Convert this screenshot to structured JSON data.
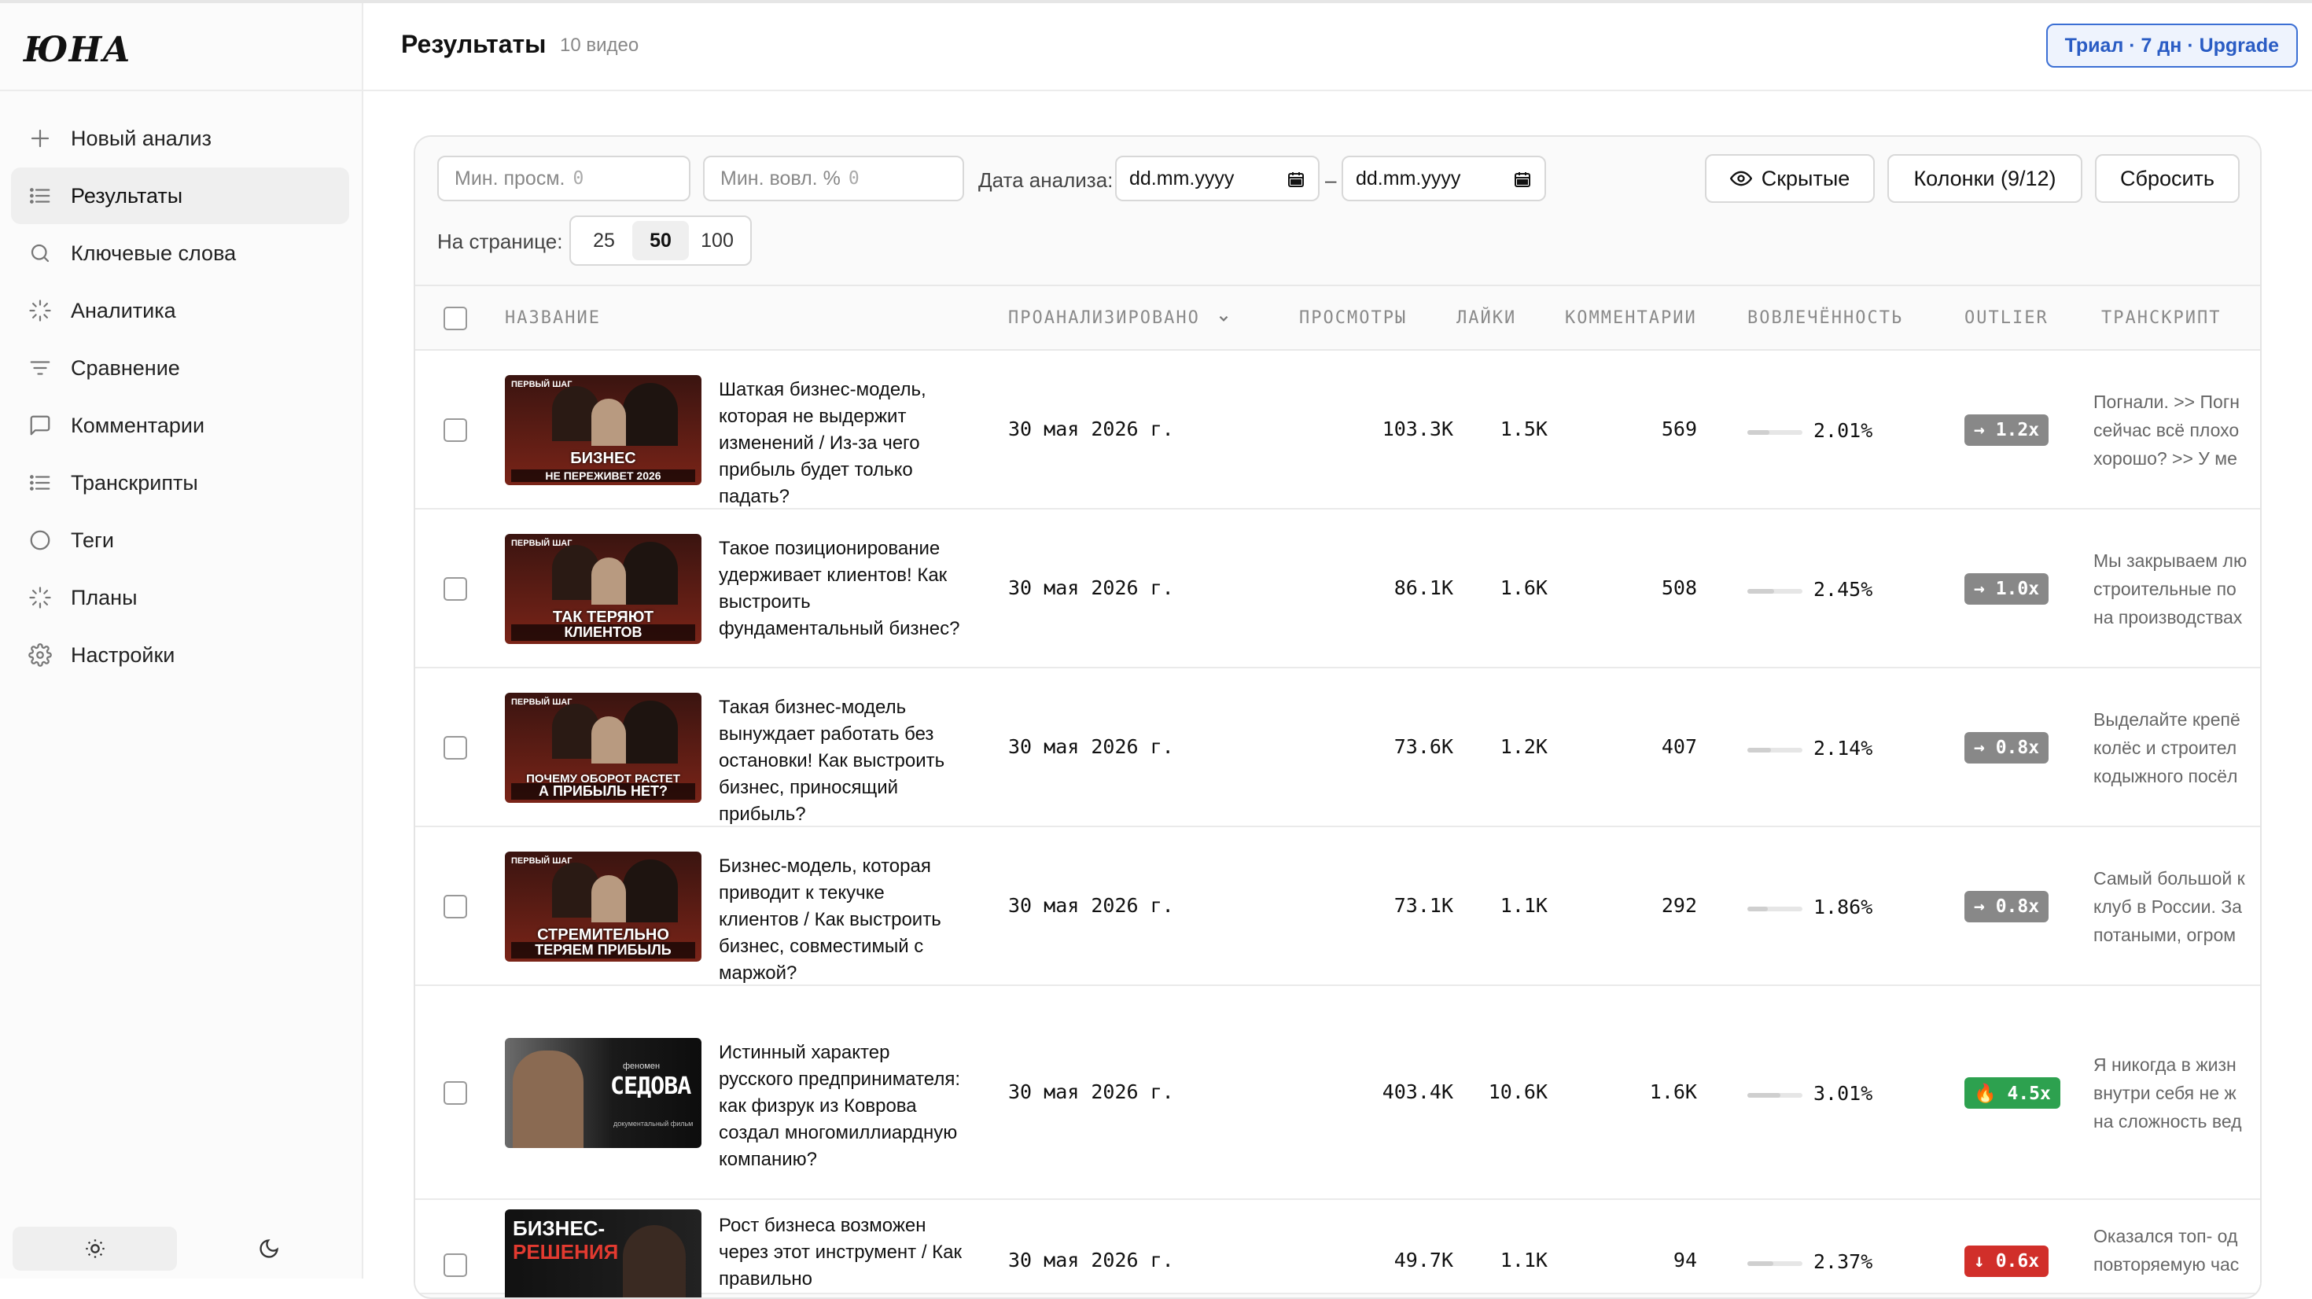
{
  "sidebar": {
    "logo": "ЮНА",
    "items": [
      {
        "label": "Новый анализ",
        "icon": "plus-icon"
      },
      {
        "label": "Результаты",
        "icon": "list-icon",
        "active": true
      },
      {
        "label": "Ключевые слова",
        "icon": "search-icon"
      },
      {
        "label": "Аналитика",
        "icon": "loader-icon"
      },
      {
        "label": "Сравнение",
        "icon": "filter-icon"
      },
      {
        "label": "Комментарии",
        "icon": "comment-icon"
      },
      {
        "label": "Транскрипты",
        "icon": "list-icon"
      },
      {
        "label": "Теги",
        "icon": "circle-icon"
      },
      {
        "label": "Планы",
        "icon": "loader-icon"
      },
      {
        "label": "Настройки",
        "icon": "gear-icon"
      }
    ],
    "theme": {
      "light_icon": "sun-icon",
      "dark_icon": "moon-icon"
    }
  },
  "header": {
    "title": "Результаты",
    "count": "10 видео",
    "trial": "Триал · 7 дн · Upgrade"
  },
  "filters": {
    "min_views_label": "Мин. просм.",
    "min_views_value": "0",
    "min_eng_label": "Мин. вовл. %",
    "min_eng_value": "0",
    "date_label": "Дата анализа:",
    "date_from": "dd.mm.yyyy",
    "date_sep": "–",
    "date_to": "dd.mm.yyyy",
    "hidden_button": "Скрытые",
    "columns_button": "Колонки (9/12)",
    "reset_button": "Сбросить",
    "per_page_label": "На странице:",
    "per_page_options": [
      "25",
      "50",
      "100"
    ],
    "per_page_selected": "50"
  },
  "table": {
    "headers": {
      "name": "НАЗВАНИЕ",
      "analyzed": "ПРОАНАЛИЗИРОВАНО",
      "views": "ПРОСМОТРЫ",
      "likes": "ЛАЙКИ",
      "comments": "КОММЕНТАРИИ",
      "engagement": "ВОВЛЕЧЁННОСТЬ",
      "outlier": "OUTLIER",
      "transcript": "ТРАНСКРИПТ"
    },
    "rows": [
      {
        "thumb_tag": "ПЕРВЫЙ ШАГ",
        "thumb_text": [
          "БИЗНЕС",
          "НЕ ПЕРЕЖИВЕТ 2026"
        ],
        "title": "Шаткая бизнес-модель, которая не выдержит изменений / Из-за чего прибыль будет только падать?",
        "analyzed": "30 мая 2026 г.",
        "views": "103.3K",
        "likes": "1.5K",
        "comments": "569",
        "engagement": "2.01%",
        "engagement_value": 2.01,
        "outlier": "→ 1.2x",
        "outlier_color": "#888888",
        "transcript": [
          "Погнали. >> Погн",
          "сейчас всё плохо",
          "хорошо? >> У ме"
        ]
      },
      {
        "thumb_tag": "ПЕРВЫЙ ШАГ",
        "thumb_text": [
          "ТАК ТЕРЯЮТ",
          "КЛИЕНТОВ"
        ],
        "title": "Такое позиционирование удерживает клиентов! Как выстроить фундаментальный бизнес?",
        "analyzed": "30 мая 2026 г.",
        "views": "86.1K",
        "likes": "1.6K",
        "comments": "508",
        "engagement": "2.45%",
        "engagement_value": 2.45,
        "outlier": "→ 1.0x",
        "outlier_color": "#888888",
        "transcript": [
          "Мы закрываем лю",
          "строительные по",
          "на производствах"
        ]
      },
      {
        "thumb_tag": "ПЕРВЫЙ ШАГ",
        "thumb_text": [
          "ПОЧЕМУ ОБОРОТ РАСТЕТ",
          "А ПРИБЫЛЬ НЕТ?"
        ],
        "title": "Такая бизнес-модель вынуждает работать без остановки! Как выстроить бизнес, приносящий прибыль?",
        "analyzed": "30 мая 2026 г.",
        "views": "73.6K",
        "likes": "1.2K",
        "comments": "407",
        "engagement": "2.14%",
        "engagement_value": 2.14,
        "outlier": "→ 0.8x",
        "outlier_color": "#888888",
        "transcript": [
          "Выделайте крепё",
          "колёс и строител",
          "кодыжного посёл"
        ]
      },
      {
        "thumb_tag": "ПЕРВЫЙ ШАГ",
        "thumb_text": [
          "СТРЕМИТЕЛЬНО",
          "ТЕРЯЕМ ПРИБЫЛЬ"
        ],
        "title": "Бизнес-модель, которая приводит к текучке клиентов / Как выстроить бизнес, совместимый с маржой?",
        "analyzed": "30 мая 2026 г.",
        "views": "73.1K",
        "likes": "1.1K",
        "comments": "292",
        "engagement": "1.86%",
        "engagement_value": 1.86,
        "outlier": "→ 0.8x",
        "outlier_color": "#888888",
        "transcript": [
          "Самый большой к",
          "клуб в России. За",
          "потаными, огром"
        ]
      },
      {
        "thumb_tag": "феномен",
        "thumb_text": [
          "СЕДОВА",
          "документальный фильм"
        ],
        "title": "Истинный характер русского предпринимателя: как физрук из Коврова создал многомиллиардную компанию?",
        "analyzed": "30 мая 2026 г.",
        "views": "403.4K",
        "likes": "10.6K",
        "comments": "1.6K",
        "engagement": "3.01%",
        "engagement_value": 3.01,
        "outlier": "🔥 4.5x",
        "outlier_color": "#2da14f",
        "transcript": [
          "Я никогда в жизн",
          "внутри себя не ж",
          "на сложность вед"
        ]
      },
      {
        "thumb_tag": "",
        "thumb_text": [
          "БИЗНЕС-",
          "РЕШЕНИЯ"
        ],
        "title": "Рост бизнеса возможен через этот инструмент / Как правильно",
        "analyzed": "30 мая 2026 г.",
        "views": "49.7K",
        "likes": "1.1K",
        "comments": "94",
        "engagement": "2.37%",
        "engagement_value": 2.37,
        "outlier": "↓ 0.6x",
        "outlier_color": "#d12f2a",
        "transcript": [
          "Оказался топ- од",
          "повторяемую час"
        ]
      }
    ]
  }
}
